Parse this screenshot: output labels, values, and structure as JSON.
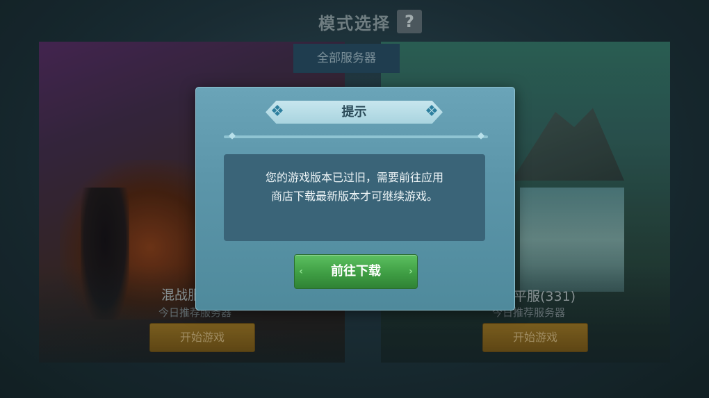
{
  "header": {
    "title": "模式选择",
    "help_label": "?"
  },
  "server_tab": {
    "label": "全部服务器"
  },
  "cards": [
    {
      "title": "混战服",
      "subtitle": "今日推荐服务器",
      "button_label": "开始游戏"
    },
    {
      "title": "平服(331)",
      "subtitle": "今日推荐服务器",
      "button_label": "开始游戏"
    }
  ],
  "dialog": {
    "title": "提示",
    "message_line1": "您的游戏版本已过旧，需要前往应用",
    "message_line2": "商店下载最新版本才可继续游戏。",
    "button_label": "前往下载"
  },
  "icons": {
    "ornament_left": "swirl-ornament-icon",
    "ornament_right": "swirl-ornament-icon",
    "help": "question-icon"
  },
  "colors": {
    "dialog_bg": "#5c96aa",
    "download_button": "#3f9e44",
    "start_button": "#7a5c1e"
  }
}
